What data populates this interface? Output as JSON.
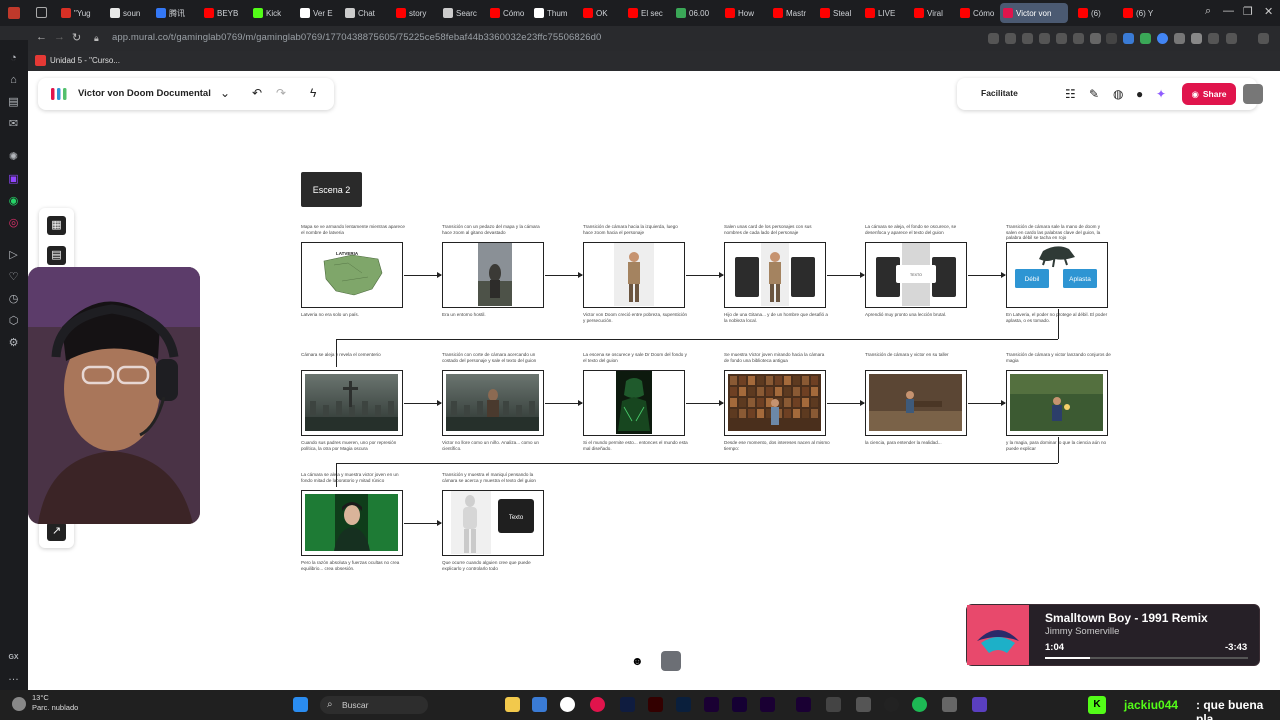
{
  "tabs": [
    {
      "label": "\"Yug",
      "color": "#d93025"
    },
    {
      "label": "soun",
      "color": "#e8e8e8"
    },
    {
      "label": "腾讯",
      "color": "#3478f6"
    },
    {
      "label": "BEYB",
      "color": "#ff0000"
    },
    {
      "label": "Kick",
      "color": "#53fc18"
    },
    {
      "label": "Ver E",
      "color": "#ffffff"
    },
    {
      "label": "Chat",
      "color": "#cccccc"
    },
    {
      "label": "story",
      "color": "#ff0000"
    },
    {
      "label": "Searc",
      "color": "#cccccc"
    },
    {
      "label": "Cómo",
      "color": "#ff0000"
    },
    {
      "label": "Thum",
      "color": "#ffffff"
    },
    {
      "label": "OK",
      "color": "#ff0000"
    },
    {
      "label": "El sec",
      "color": "#ff0000"
    },
    {
      "label": "06.00",
      "color": "#3aa757"
    },
    {
      "label": "How",
      "color": "#ff0000"
    },
    {
      "label": "Mastr",
      "color": "#ff0000"
    },
    {
      "label": "Steal",
      "color": "#ff0000"
    },
    {
      "label": "LIVE",
      "color": "#ff0000"
    },
    {
      "label": "Viral",
      "color": "#ff0000"
    },
    {
      "label": "Cómo",
      "color": "#ff0000"
    },
    {
      "label": "Victor von",
      "color": "#e0144c"
    },
    {
      "label": "(6)",
      "color": "#ff0000"
    },
    {
      "label": "(6) Y",
      "color": "#ff0000"
    }
  ],
  "browser": {
    "url": "app.mural.co/t/gaminglab0769/m/gaminglab0769/1770438875605/75225ce58febaf44b3360032e23ffc75506826d0",
    "bookmark": "Unidad 5 - \"Curso..."
  },
  "app": {
    "title": "Victor von Doom Documental",
    "facilitate": "Facilitate",
    "share": "Share"
  },
  "scene_label": "Escena 2",
  "frames": [
    {
      "top": "Mapa se ve armando lentamente mientras aparece el nombre de latveria",
      "bottom": "Latveria no era solo un país.",
      "mapLabel": "LATVERIA"
    },
    {
      "top": "Transición con un pedazo del mapa y la cámara hace zoom al gitano devastado",
      "bottom": "Era un entorno hostil."
    },
    {
      "top": "Transición de cámara hacia la izquierda, luego hace zoom hacia el personaje",
      "bottom": "Victor von Doom creció entre pobreza, superstición y persecución."
    },
    {
      "top": "Salen unas card de los personajes con sus nombres de cada lado del personaje",
      "bottom": "Hijo de una Gitana... y de un hombre que desafió a la nobleza local."
    },
    {
      "top": "La cámara se aleja, el fondo se oscurece, se desenfoca y aparece el texto del guion",
      "bottom": "Aprendió muy pronto una lección brutal.",
      "cardText": "TEXTO"
    },
    {
      "top": "Transición de cámara sale la mano de doom y salen en cardo las palabras clave del guion, la palabra débil se tacha en rojo",
      "bottom": "En Latveria, el poder no protege al débil. El poder aplasta, o es tomado.",
      "btn1": "Débil",
      "btn2": "Aplasta"
    },
    {
      "top": "Cámara se aleja y revela el cementerio",
      "bottom": "Cuando sus padres mueren, uno por represión política, la otra por Magia oscura"
    },
    {
      "top": "Transición con corte de cámara acercando un costado del personaje y sale el texto del guion",
      "bottom": "Victor no llore como un niño. Analiza... como un científico."
    },
    {
      "top": "La escena se oscurece y sale Dr Doom del fondo y el texto del guion",
      "bottom": "Si el mundo permite esto... entonces el mundo esta mal diseñado."
    },
    {
      "top": "Se muestra Victor joven mirando hacia la cámara de fondo una biblioteca antigua",
      "bottom": "Desde ese momento, dos intereses nacen al mismo tiempo:"
    },
    {
      "top": "Transición de cámara y victor en su taller",
      "bottom": "la ciencia, para entender la realidad..."
    },
    {
      "top": "Transición de cámara y victor lanzando conjuros de magia",
      "bottom": "y la magia, para dominar lo que la ciencia aún no puede explicar"
    },
    {
      "top": "La cámara se aleja y muestra victor joven en un fondo mitad de laboratorio y mitad rúnico",
      "bottom": "Pero la razón absoluta y fuerzas ocultas no crea equilibrio... crea obsesión."
    },
    {
      "top": "Transición y muestra el maniquí pensando la cámara se acerca y muestra el texto del guion",
      "bottom": "Que ocurre cuando alguien cree que puede explicarlo y controlarlo todo",
      "cardText": "Texto"
    }
  ],
  "music": {
    "title": "Smalltown Boy - 1991 Remix",
    "artist": "Jimmy Somerville",
    "current": "1:04",
    "remaining": "-3:43",
    "progress": 0.22
  },
  "taskbar": {
    "temp": "13°C",
    "weather": "Parc. nublado",
    "search": "Buscar"
  },
  "chat": {
    "user": "jackiu044",
    "message": ": que buena pla"
  },
  "colors": {
    "accent": "#e0144c",
    "kick": "#53fc18",
    "button_blue": "#2e95d3"
  }
}
